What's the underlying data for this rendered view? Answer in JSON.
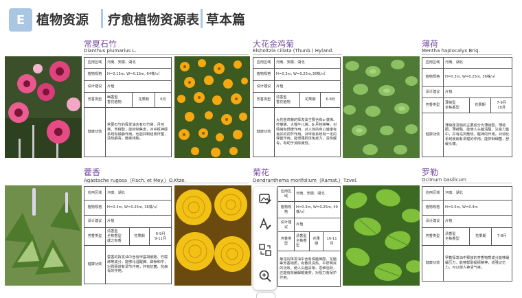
{
  "header": {
    "badge": "E",
    "title1": "植物资源",
    "title2": "疗愈植物资源表",
    "title3": "草本篇"
  },
  "labels": {
    "region": "应用区域",
    "spec": "植物规格",
    "design": "设计建议",
    "aroma": "芳香类型",
    "flowering": "花果期",
    "health": "健康功效"
  },
  "cards": [
    {
      "name": "常夏石竹",
      "latin": "Dianthus plumarius L.",
      "region": "河南、安徽、湖北",
      "spec": "H=0.15m, W=0.15m, 64株/㎡",
      "design": "片植",
      "aroma": "幽香型\n香花植物",
      "flowering": "6月",
      "health": "常夏石竹的挥发油含有石竹烯、月桂烯、芳樟醇，能抑制焦虑，对中枢神经系统有镇静作用，也能抑制结核杆菌，清热解毒，散瘀排脓。"
    },
    {
      "name": "大花金鸡菊",
      "latin": "Elsholtzia ciliata (Thunb.) Hyland.",
      "region": "河南、安徽、湖北",
      "spec": "H=0.3m, W=0.25m,36株/㎡",
      "design": "片植",
      "aroma": "清香型\n香花植物",
      "flowering": "6-8月",
      "health": "大花金鸡菊的挥发油主要含有α-蒎烯、柠檬烯、大牻牛儿烯、β-月桂烯等，对情绪有舒缓作用，对人体的身心健康有良好的调节作用，对呼吸系统有一定的保健作用，能增强机体免疫力，清热解毒，有助于消除疲劳。"
    },
    {
      "name": "薄荷",
      "latin": "Mentha haplocalyx Briq.",
      "region": "河南、湖北",
      "spec": "H=0.3m, W=0.25m, 36株/㎡",
      "design": "片植",
      "aroma": "薄荷型\n全株香型",
      "flowering": "7-9月\n10月",
      "health": "薄荷挥发物的主要成分为薄荷醇、薄荷酮、薄荷酯，能使人头脑清醒、注意力集中，并有祛风散热、醒神的作用，对消化系统疾病有调理的作用，能抑制细菌，舒缓头痛。"
    },
    {
      "name": "藿香",
      "latin": "Agastache rugosa（Fisch. et Mey.）O.Ktze.",
      "region": "河南、湖北",
      "spec": "H=0.3m, W=0.25m, 36株/㎡",
      "design": "片植",
      "aroma": "清香型\n全株香型\n或之有香",
      "flowering": "6-9月\n9-11月",
      "health": "藿香的挥发油中含有甲基胡椒酚、柠檬烯等成分，能够化湿醒脾、辟秽和中，对胃肠道有调节作用，并有抗菌、抗病毒的作用。"
    },
    {
      "name": "菊花",
      "latin": "Dendranthema morifolium（Ramat.）Tzvel.",
      "region": "河南、安徽、湖北",
      "spec": "H=0.3m, W=0.25m, 49株/㎡",
      "design": "片植",
      "aroma": "清香型\n全株香型",
      "flowering": "10-11月",
      "health": "菊花的挥发油中含有樟脑烯醇、龙脑等芳香物质，有散风清热、平肝明目的功效，使人头脑清晰、思维活跃，还能有效缓解眼疲劳，对视力有保护作用。"
    },
    {
      "name": "罗勒",
      "latin": "Ocimum basilicum",
      "region": "河南、湖北",
      "spec": "H=0.5m, W=0.4m",
      "design": "片植",
      "aroma": "清香型\n全株香型",
      "flowering": "7-8月",
      "health": "罗勒挥发油中释放的芳香物质成分能够缓解压力，能够帮助提振精神，增强记忆力，可以使人神清气爽。"
    }
  ]
}
